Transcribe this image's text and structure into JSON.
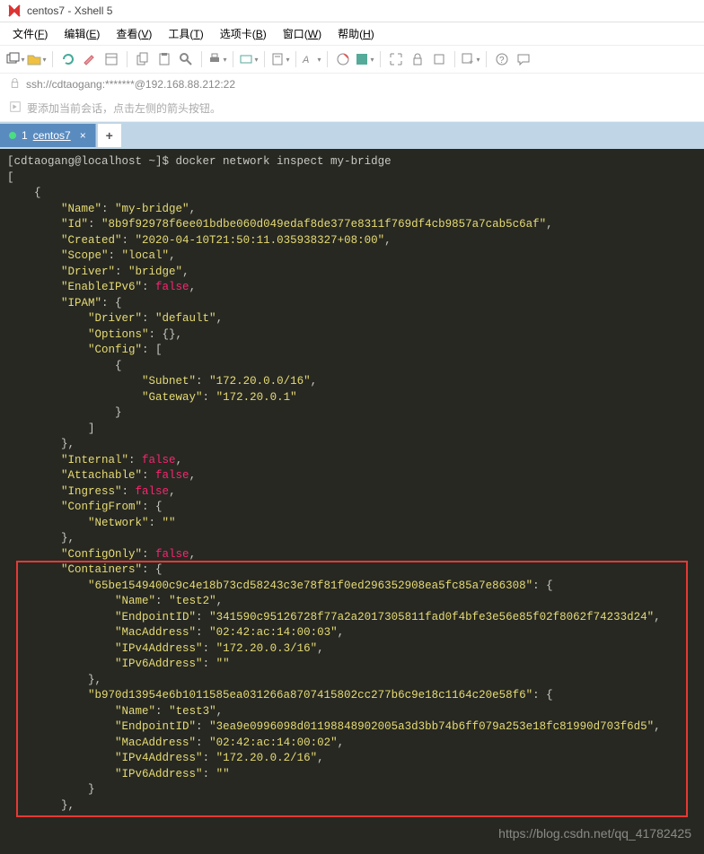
{
  "window": {
    "title": "centos7 - Xshell 5"
  },
  "menu": {
    "items": [
      {
        "label": "文件",
        "accel": "F"
      },
      {
        "label": "编辑",
        "accel": "E"
      },
      {
        "label": "查看",
        "accel": "V"
      },
      {
        "label": "工具",
        "accel": "T"
      },
      {
        "label": "选项卡",
        "accel": "B"
      },
      {
        "label": "窗口",
        "accel": "W"
      },
      {
        "label": "帮助",
        "accel": "H"
      }
    ]
  },
  "address": {
    "text": "ssh://cdtaogang:*******@192.168.88.212:22"
  },
  "hint": {
    "text": "要添加当前会话，点击左侧的箭头按钮。"
  },
  "tabs": {
    "items": [
      {
        "index": "1",
        "label": "centos7"
      }
    ]
  },
  "terminal": {
    "prompt": "[cdtaogang@localhost ~]$ ",
    "command": "docker network inspect my-bridge",
    "highlight_start_line": 25,
    "json_lines": [
      "[",
      "    {",
      "        \"Name\": \"my-bridge\",",
      "        \"Id\": \"8b9f92978f6ee01bdbe060d049edaf8de377e8311f769df4cb9857a7cab5c6af\",",
      "        \"Created\": \"2020-04-10T21:50:11.035938327+08:00\",",
      "        \"Scope\": \"local\",",
      "        \"Driver\": \"bridge\",",
      "        \"EnableIPv6\": false,",
      "        \"IPAM\": {",
      "            \"Driver\": \"default\",",
      "            \"Options\": {},",
      "            \"Config\": [",
      "                {",
      "                    \"Subnet\": \"172.20.0.0/16\",",
      "                    \"Gateway\": \"172.20.0.1\"",
      "                }",
      "            ]",
      "        },",
      "        \"Internal\": false,",
      "        \"Attachable\": false,",
      "        \"Ingress\": false,",
      "        \"ConfigFrom\": {",
      "            \"Network\": \"\"",
      "        },",
      "        \"ConfigOnly\": false,",
      "        \"Containers\": {",
      "            \"65be1549400c9c4e18b73cd58243c3e78f81f0ed296352908ea5fc85a7e86308\": {",
      "                \"Name\": \"test2\",",
      "                \"EndpointID\": \"341590c95126728f77a2a2017305811fad0f4bfe3e56e85f02f8062f74233d24\",",
      "                \"MacAddress\": \"02:42:ac:14:00:03\",",
      "                \"IPv4Address\": \"172.20.0.3/16\",",
      "                \"IPv6Address\": \"\"",
      "            },",
      "            \"b970d13954e6b1011585ea031266a8707415802cc277b6c9e18c1164c20e58f6\": {",
      "                \"Name\": \"test3\",",
      "                \"EndpointID\": \"3ea9e0996098d01198848902005a3d3bb74b6ff079a253e18fc81990d703f6d5\",",
      "                \"MacAddress\": \"02:42:ac:14:00:02\",",
      "                \"IPv4Address\": \"172.20.0.2/16\",",
      "                \"IPv6Address\": \"\"",
      "            }",
      "        },"
    ]
  },
  "watermark": {
    "text": "https://blog.csdn.net/qq_41782425"
  },
  "icons": {
    "app": "xshell-icon",
    "lock": "lock-icon",
    "arrow": "arrow-right-icon"
  }
}
